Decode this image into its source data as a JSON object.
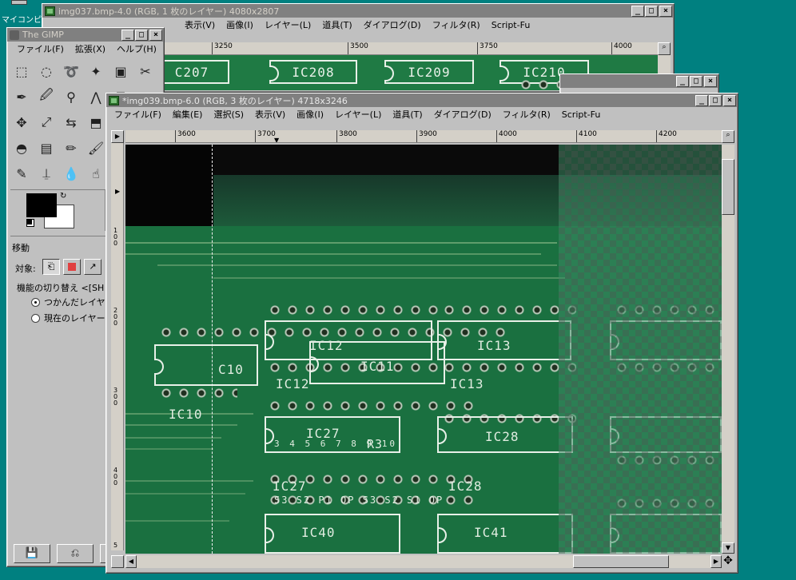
{
  "desktop": {
    "icon_label": "マイコンピ"
  },
  "win_back": {
    "title": "img037.bmp-4.0 (RGB, 1 枚のレイヤー) 4080x2807",
    "menu": [
      "表示(V)",
      "画像(I)",
      "レイヤー(L)",
      "道具(T)",
      "ダイアログ(D)",
      "フィルタ(R)",
      "Script-Fu"
    ],
    "ruler": [
      "3250",
      "3500",
      "3750",
      "4000"
    ],
    "chips": [
      "C207",
      "IC208",
      "IC209",
      "IC210"
    ]
  },
  "toolbox": {
    "title": "The GIMP",
    "menu": [
      "ファイル(F)",
      "拡張(X)",
      "ヘルプ(H)"
    ],
    "icons": [
      "rect-select-icon",
      "ellipse-select-icon",
      "lasso-icon",
      "fuzzy-select-icon",
      "color-select-icon",
      "scissors-icon",
      "bezier-icon",
      "color-picker-icon",
      "zoom-icon",
      "measure-icon",
      "text-icon",
      "crop-icon",
      "move-icon",
      "transform-icon",
      "flip-icon",
      "perspective-icon",
      "text-tool-icon",
      "clone-icon",
      "bucket-fill-icon",
      "gradient-icon",
      "pencil-icon",
      "paintbrush-icon",
      "eraser-icon",
      "airbrush-icon",
      "ink-icon",
      "stamp-icon",
      "blur-icon",
      "smudge-icon",
      "dodge-icon",
      "path-icon"
    ],
    "options": {
      "heading": "移動",
      "target_label": "対象:",
      "toggle_label": "機能の切り替え <[SH",
      "radio1": "つかんだレイヤー",
      "radio2": "現在のレイヤーを"
    }
  },
  "win_front": {
    "title": "*img039.bmp-6.0 (RGB, 3 枚のレイヤー) 4718x3246",
    "menu": [
      "ファイル(F)",
      "編集(E)",
      "選択(S)",
      "表示(V)",
      "画像(I)",
      "レイヤー(L)",
      "道具(T)",
      "ダイアログ(D)",
      "フィルタ(R)",
      "Script-Fu"
    ],
    "ruler": [
      "3600",
      "3700",
      "3800",
      "3900",
      "4000",
      "4100",
      "4200"
    ],
    "vruler": [
      "1 0 0",
      "2 0 0",
      "3 0 0",
      "4 0 0",
      "5"
    ],
    "pcb_labels": {
      "ic12a": "IC12",
      "ic13a": "IC13",
      "ic12b": "IC12",
      "ic11": "IC11",
      "ic13b": "IC13",
      "c10": "C10",
      "ic10": "IC10",
      "ic27": "IC27",
      "ic28": "IC28",
      "ic27b": "IC27",
      "ic28b": "IC28",
      "ic40": "IC40",
      "ic41": "IC41",
      "r3": "R3",
      "nums": "3   4   5   6   7   8   9   10",
      "vtext": "S3  S2  P1  OP  S3  S2  S1  OP"
    }
  }
}
